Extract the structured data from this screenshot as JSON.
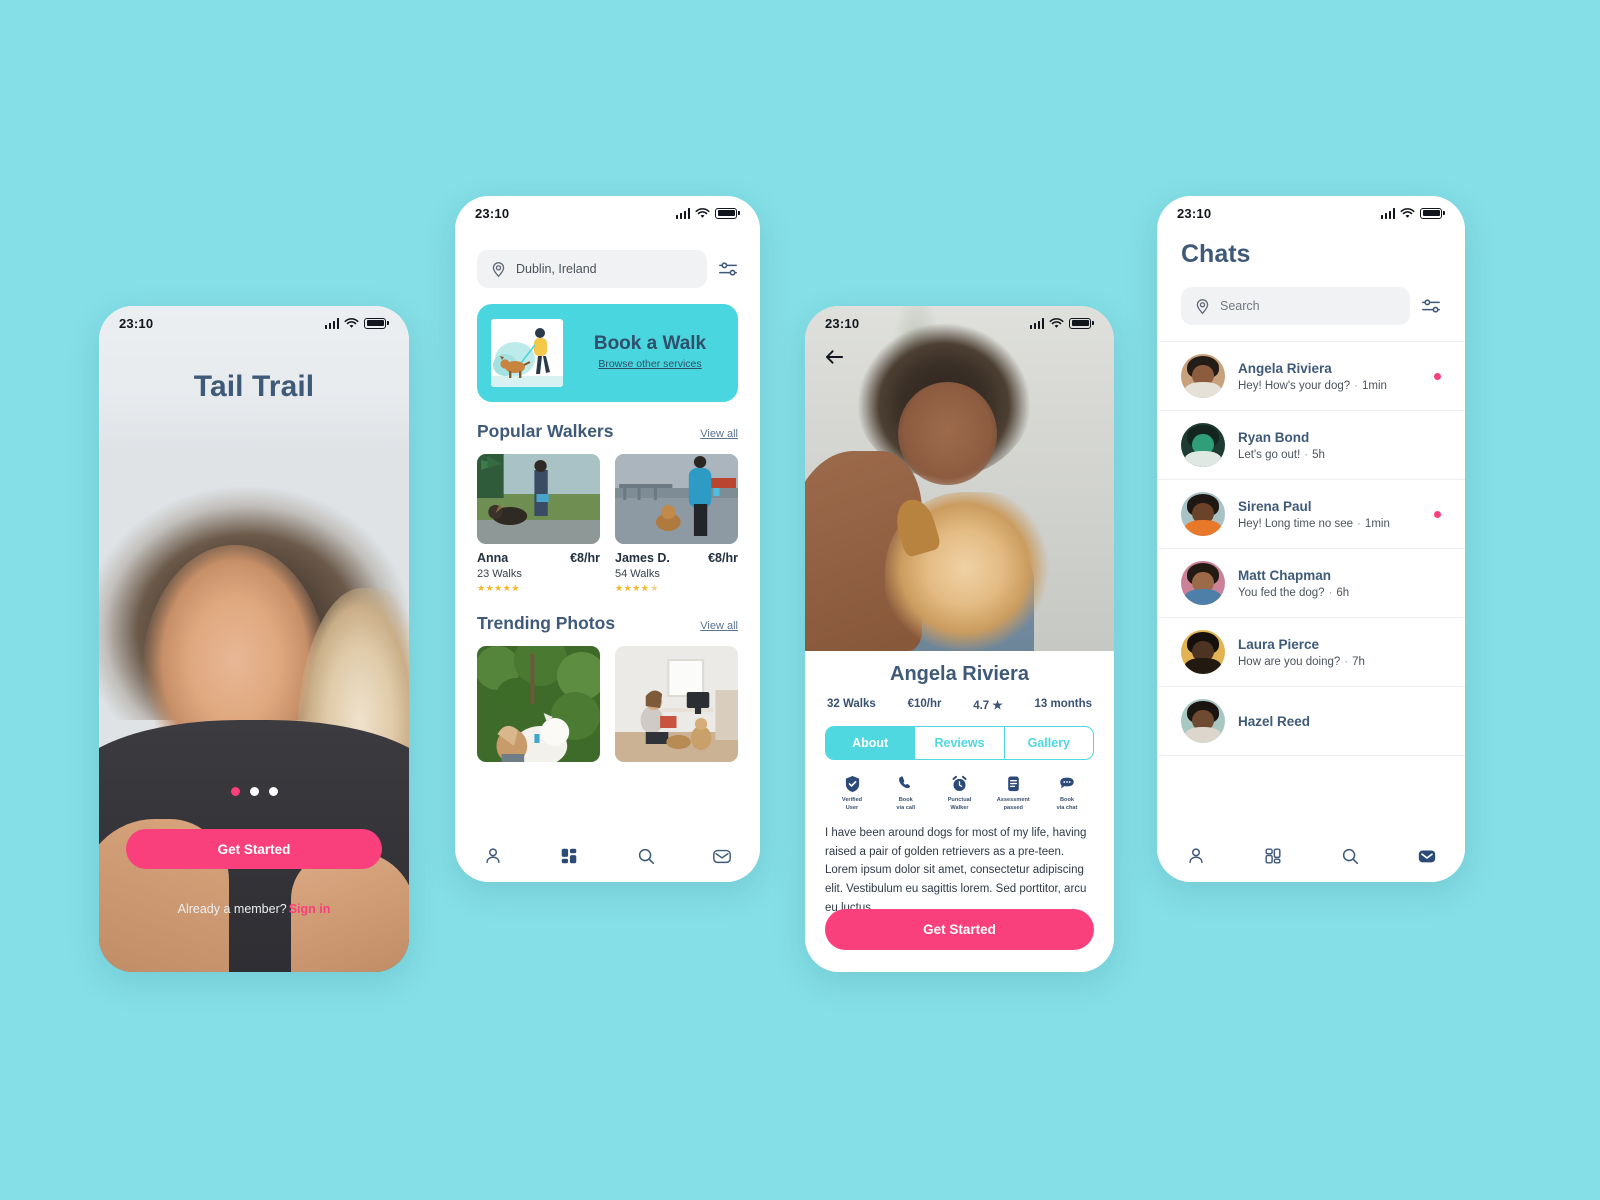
{
  "background_color": "#84dfe7",
  "accent_pink": "#f9407c",
  "accent_teal": "#4fd8e0",
  "navy": "#3f5a79",
  "status_bar": {
    "time": "23:10",
    "signal_icon": "cellular-bars-icon",
    "wifi_icon": "wifi-icon",
    "battery_icon": "battery-icon"
  },
  "onboarding": {
    "app_title": "Tail Trail",
    "cta_label": "Get Started",
    "footer_text": "Already a member?",
    "signin_label": "Sign in",
    "pagination": {
      "total": 3,
      "active_index": 0
    }
  },
  "home": {
    "location_value": "Dublin, Ireland",
    "location_icon": "location-pin-icon",
    "filter_icon": "filter-sliders-icon",
    "promo": {
      "title": "Book a Walk",
      "link": "Browse other services",
      "illustration": "dog-walker-illustration"
    },
    "sections": [
      {
        "title": "Popular Walkers",
        "link": "View all"
      },
      {
        "title": "Trending Photos",
        "link": "View all"
      }
    ],
    "walkers": [
      {
        "name": "Anna",
        "price": "€8/hr",
        "walks": "23 Walks",
        "rating": 5,
        "photo": "walker-anna-photo"
      },
      {
        "name": "James D.",
        "price": "€8/hr",
        "walks": "54 Walks",
        "rating": 4.5,
        "photo": "walker-james-photo"
      }
    ],
    "photos": [
      "trending-photo-dog-forest",
      "trending-photo-woman-room"
    ],
    "tabs": [
      {
        "icon": "person-icon",
        "active": false
      },
      {
        "icon": "grid-icon",
        "active": true
      },
      {
        "icon": "search-icon",
        "active": false
      },
      {
        "icon": "envelope-icon",
        "active": false
      }
    ]
  },
  "profile": {
    "back_icon": "arrow-left-icon",
    "hero_photo": "angela-with-dog-photo",
    "name": "Angela Riviera",
    "stats": [
      "32 Walks",
      "€10/hr",
      "4.7 ★",
      "13 months"
    ],
    "tabs": [
      {
        "label": "About",
        "active": true
      },
      {
        "label": "Reviews",
        "active": false
      },
      {
        "label": "Gallery",
        "active": false
      }
    ],
    "badges": [
      {
        "icon": "shield-check-icon",
        "line1": "Verified",
        "line2": "User"
      },
      {
        "icon": "phone-icon",
        "line1": "Book",
        "line2": "via call"
      },
      {
        "icon": "alarm-clock-icon",
        "line1": "Punctual",
        "line2": "Walker"
      },
      {
        "icon": "document-icon",
        "line1": "Assessment",
        "line2": "passed"
      },
      {
        "icon": "chat-bubble-icon",
        "line1": "Book",
        "line2": "via chat"
      }
    ],
    "bio": "I have been around dogs for most of my life, having raised a pair of golden retrievers as a pre-teen. Lorem ipsum dolor sit amet, consectetur adipiscing elit. Vestibulum eu sagittis lorem. Sed porttitor, arcu eu luctus",
    "cta_label": "Get Started"
  },
  "chats": {
    "title": "Chats",
    "search_placeholder": "Search",
    "search_icon": "location-pin-icon",
    "filter_icon": "filter-sliders-icon",
    "items": [
      {
        "name": "Angela Riviera",
        "preview": "Hey! How's your dog?",
        "time": "1min",
        "unread": true,
        "avatar": "avatar-angela"
      },
      {
        "name": "Ryan Bond",
        "preview": "Let's go out!",
        "time": "5h",
        "unread": false,
        "avatar": "avatar-ryan"
      },
      {
        "name": "Sirena Paul",
        "preview": "Hey! Long time no see",
        "time": "1min",
        "unread": true,
        "avatar": "avatar-sirena"
      },
      {
        "name": "Matt Chapman",
        "preview": "You fed the dog?",
        "time": "6h",
        "unread": false,
        "avatar": "avatar-matt"
      },
      {
        "name": "Laura Pierce",
        "preview": "How are you doing?",
        "time": "7h",
        "unread": false,
        "avatar": "avatar-laura"
      },
      {
        "name": "Hazel Reed",
        "preview": "",
        "time": "",
        "unread": false,
        "avatar": "avatar-hazel"
      }
    ],
    "tabs": [
      {
        "icon": "person-icon",
        "active": false
      },
      {
        "icon": "grid-icon",
        "active": false
      },
      {
        "icon": "search-icon",
        "active": false
      },
      {
        "icon": "envelope-icon",
        "active": true
      }
    ]
  }
}
